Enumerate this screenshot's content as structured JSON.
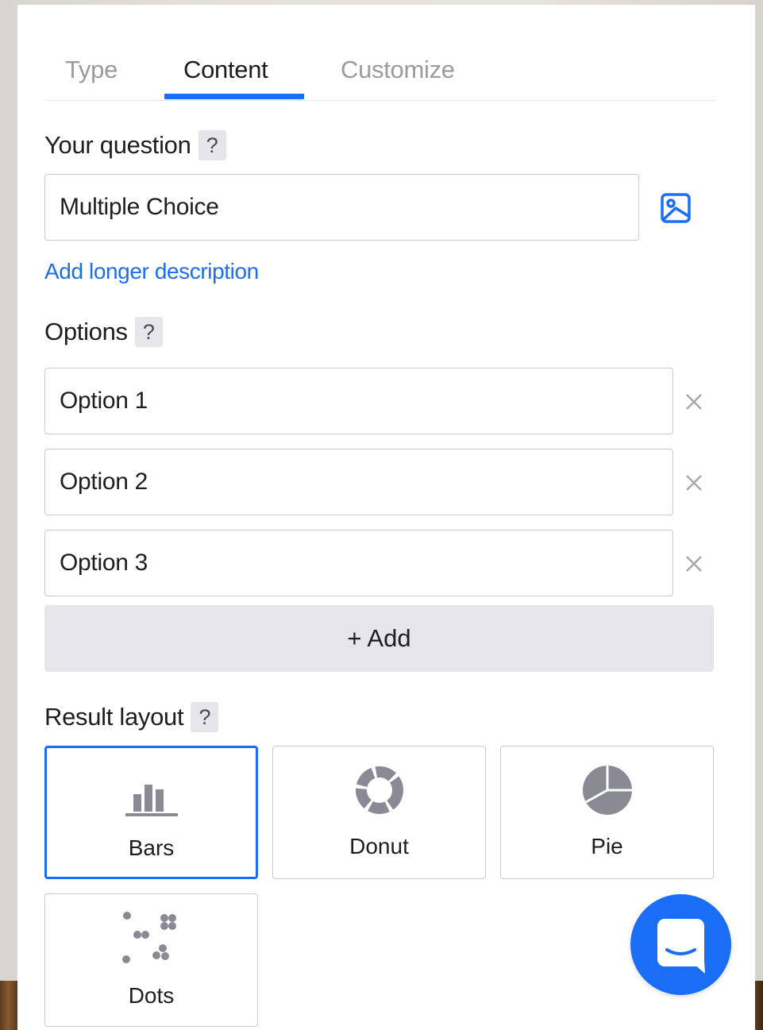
{
  "tabs": [
    {
      "label": "Type",
      "active": false
    },
    {
      "label": "Content",
      "active": true
    },
    {
      "label": "Customize",
      "active": false
    }
  ],
  "question": {
    "label": "Your question",
    "help": "?",
    "value": "Multiple Choice",
    "add_description": "Add longer description"
  },
  "options": {
    "label": "Options",
    "help": "?",
    "items": [
      {
        "value": "Option 1"
      },
      {
        "value": "Option 2"
      },
      {
        "value": "Option 3"
      }
    ],
    "add_label": "+ Add"
  },
  "result_layout": {
    "label": "Result layout",
    "help": "?",
    "selected": "Bars",
    "cards": [
      {
        "label": "Bars",
        "icon": "bars-chart-icon"
      },
      {
        "label": "Donut",
        "icon": "donut-chart-icon"
      },
      {
        "label": "Pie",
        "icon": "pie-chart-icon"
      },
      {
        "label": "Dots",
        "icon": "dots-chart-icon"
      }
    ]
  },
  "colors": {
    "accent": "#1a6ef5",
    "text": "#1d1d22",
    "muted": "#9a9aa2",
    "border": "#c9c9ce",
    "button_bg": "#e6e6ea",
    "icon_gray": "#8a8a94"
  }
}
